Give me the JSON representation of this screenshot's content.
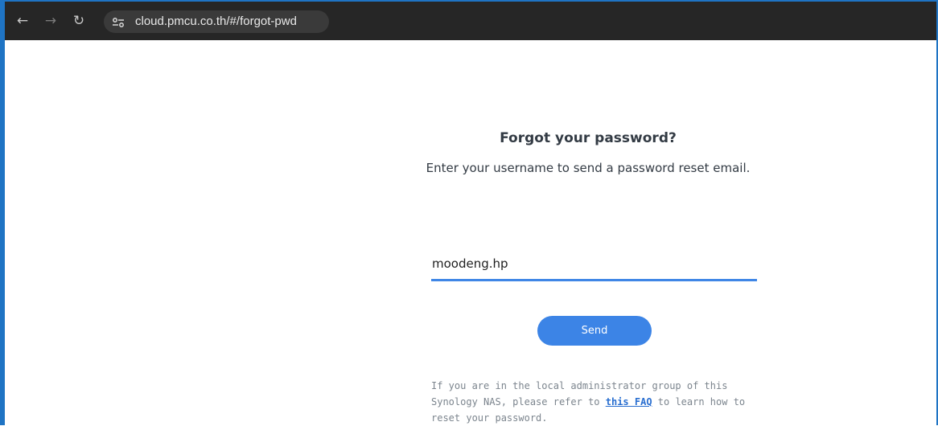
{
  "browser": {
    "url": "cloud.pmcu.co.th/#/forgot-pwd",
    "icons": {
      "back": "arrow-left-icon",
      "forward": "arrow-right-icon",
      "reload": "reload-icon",
      "site_info": "tune-icon"
    }
  },
  "form": {
    "title": "Forgot your password?",
    "subtitle": "Enter your username to send a password reset email.",
    "username_value": "moodeng.hp",
    "send_label": "Send"
  },
  "help": {
    "text_before": "If you are in the local administrator group of this Synology NAS, please refer to",
    "link_text": "this FAQ",
    "text_after": "to learn how to reset your password."
  },
  "colors": {
    "accent": "#3c84e6",
    "browser_bar": "#262626",
    "window_border": "#1f74c4",
    "link": "#2a6fd0"
  }
}
